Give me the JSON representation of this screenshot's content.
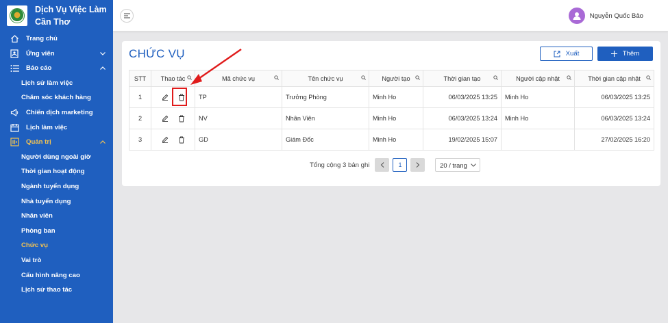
{
  "sidebar": {
    "brand_line1": "Dịch Vụ Việc Làm",
    "brand_line2": "Cần Thơ",
    "items": [
      {
        "label": "Trang chủ",
        "icon": "home-icon",
        "chevron": ""
      },
      {
        "label": "Ứng viên",
        "icon": "user-file-icon",
        "chevron": "down"
      },
      {
        "label": "Báo cáo",
        "icon": "list-icon",
        "chevron": "up"
      },
      {
        "label": "Lịch sử làm việc",
        "sub": true
      },
      {
        "label": "Chăm sóc khách hàng",
        "sub": true
      },
      {
        "label": "Chiến dịch marketing",
        "icon": "megaphone-icon",
        "chevron": ""
      },
      {
        "label": "Lịch làm việc",
        "icon": "calendar-icon",
        "chevron": ""
      },
      {
        "label": "Quản trị",
        "icon": "admin-icon",
        "chevron": "up",
        "open": true
      },
      {
        "label": "Người dùng ngoài giờ",
        "sub": true
      },
      {
        "label": "Thời gian hoạt động",
        "sub": true
      },
      {
        "label": "Ngành tuyển dụng",
        "sub": true
      },
      {
        "label": "Nhà tuyển dụng",
        "sub": true
      },
      {
        "label": "Nhân viên",
        "sub": true
      },
      {
        "label": "Phòng ban",
        "sub": true
      },
      {
        "label": "Chức vụ",
        "sub": true,
        "active": true
      },
      {
        "label": "Vai trò",
        "sub": true
      },
      {
        "label": "Cấu hình nâng cao",
        "sub": true
      },
      {
        "label": "Lịch sử thao tác",
        "sub": true
      }
    ]
  },
  "header": {
    "user_name": "Nguyễn Quốc Bảo"
  },
  "main": {
    "title": "CHỨC VỤ",
    "export_label": "Xuất",
    "add_label": "Thêm",
    "columns": [
      "STT",
      "Thao tác",
      "Mã chức vụ",
      "Tên chức vụ",
      "Người tạo",
      "Thời gian tạo",
      "Người cập nhật",
      "Thời gian cập nhật"
    ],
    "rows": [
      {
        "stt": "1",
        "code": "TP",
        "name": "Trưởng Phòng",
        "creator": "Minh Ho",
        "created": "06/03/2025 13:25",
        "updater": "Minh Ho",
        "updated": "06/03/2025 13:25"
      },
      {
        "stt": "2",
        "code": "NV",
        "name": "Nhân Viên",
        "creator": "Minh Ho",
        "created": "06/03/2025 13:24",
        "updater": "Minh Ho",
        "updated": "06/03/2025 13:24"
      },
      {
        "stt": "3",
        "code": "GD",
        "name": "Giám Đốc",
        "creator": "Minh Ho",
        "created": "19/02/2025 15:07",
        "updater": "",
        "updated": "27/02/2025 16:20"
      }
    ],
    "pagination": {
      "total_text": "Tổng cộng 3 bản ghi",
      "current_page": "1",
      "page_size": "20 / trang"
    }
  },
  "colors": {
    "sidebar_bg": "#1f5fbf",
    "active_text": "#f5c451",
    "primary": "#1f5fbf",
    "annotation_red": "#e01b1b"
  }
}
